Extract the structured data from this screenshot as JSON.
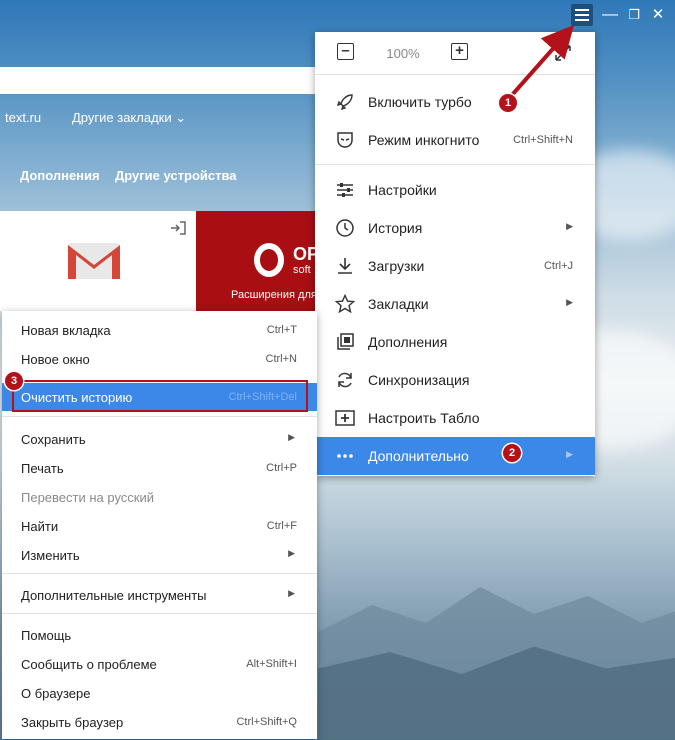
{
  "zoom": {
    "value": "100%"
  },
  "bookmarks": {
    "site": "text.ru",
    "other": "Другие закладки"
  },
  "tabs": {
    "addons": "Дополнения",
    "devices": "Другие устройства"
  },
  "tiles": {
    "opera_brand": "OPE",
    "opera_sub": "soft",
    "opera_caption": "Расширения для"
  },
  "main_menu": [
    {
      "label": "Включить турбо",
      "shortcut": "",
      "icon": "rocket-icon"
    },
    {
      "label": "Режим инкогнито",
      "shortcut": "Ctrl+Shift+N",
      "icon": "incognito-mask-icon"
    },
    {
      "label": "Настройки",
      "shortcut": "",
      "icon": "settings-sliders-icon"
    },
    {
      "label": "История",
      "shortcut": "",
      "icon": "history-clock-icon"
    },
    {
      "label": "Загрузки",
      "shortcut": "Ctrl+J",
      "icon": "download-icon"
    },
    {
      "label": "Закладки",
      "shortcut": "",
      "icon": "star-icon"
    },
    {
      "label": "Дополнения",
      "shortcut": "",
      "icon": "addons-icon"
    },
    {
      "label": "Синхронизация",
      "shortcut": "",
      "icon": "sync-icon"
    },
    {
      "label": "Настроить Табло",
      "shortcut": "",
      "icon": "add-tile-icon"
    },
    {
      "label": "Дополнительно",
      "shortcut": "",
      "icon": "more-dots-icon"
    }
  ],
  "context_menu": [
    {
      "label": "Новая вкладка",
      "shortcut": "Ctrl+T"
    },
    {
      "label": "Новое окно",
      "shortcut": "Ctrl+N"
    },
    {
      "label": "Очистить историю",
      "shortcut": "Ctrl+Shift+Del"
    },
    {
      "label": "Сохранить",
      "shortcut": ""
    },
    {
      "label": "Печать",
      "shortcut": "Ctrl+P"
    },
    {
      "label": "Перевести на русский",
      "shortcut": ""
    },
    {
      "label": "Найти",
      "shortcut": "Ctrl+F"
    },
    {
      "label": "Изменить",
      "shortcut": ""
    },
    {
      "label": "Дополнительные инструменты",
      "shortcut": ""
    },
    {
      "label": "Помощь",
      "shortcut": ""
    },
    {
      "label": "Сообщить о проблеме",
      "shortcut": "Alt+Shift+I"
    },
    {
      "label": "О браузере",
      "shortcut": ""
    },
    {
      "label": "Закрыть браузер",
      "shortcut": "Ctrl+Shift+Q"
    }
  ],
  "badges": {
    "one": "1",
    "two": "2",
    "three": "3"
  },
  "colors": {
    "highlight": "#3c88e8",
    "annotation_red": "#b3121b"
  }
}
